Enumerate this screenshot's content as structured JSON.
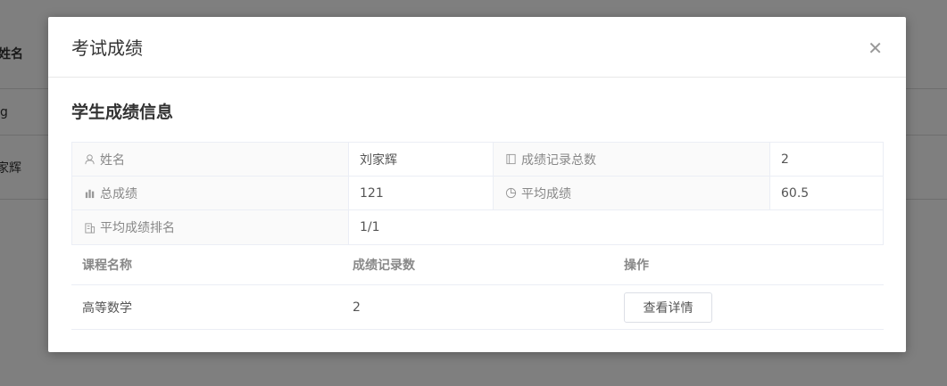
{
  "background": {
    "header_name": "姓名",
    "rows": [
      "g",
      "家辉"
    ]
  },
  "modal": {
    "title": "考试成绩",
    "close_icon": "close-icon",
    "section_title": "学生成绩信息",
    "info": {
      "name_label": "姓名",
      "name_value": "刘家辉",
      "record_count_label": "成绩记录总数",
      "record_count_value": "2",
      "total_label": "总成绩",
      "total_value": "121",
      "avg_label": "平均成绩",
      "avg_value": "60.5",
      "rank_label": "平均成绩排名",
      "rank_value": "1/1"
    },
    "table": {
      "headers": [
        "课程名称",
        "成绩记录数",
        "操作"
      ],
      "rows": [
        {
          "course": "高等数学",
          "count": "2",
          "action": "查看详情"
        }
      ]
    }
  }
}
